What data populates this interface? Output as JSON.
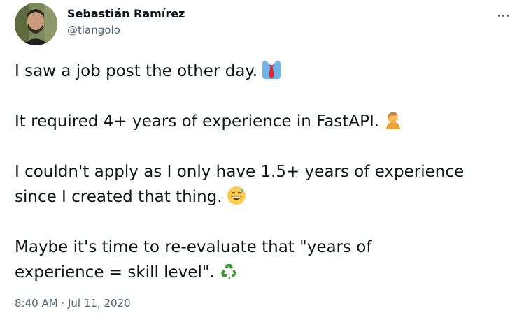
{
  "author": {
    "name": "Sebastián Ramírez",
    "handle": "@tiangolo",
    "avatar": "profile-photo"
  },
  "menu": {
    "icon": "more-horizontal-icon"
  },
  "tweet": {
    "paragraphs": [
      {
        "lines": [
          "I saw a job post the other day."
        ],
        "emoji": "necktie-emoji"
      },
      {
        "lines": [
          "It required 4+ years of experience in FastAPI."
        ],
        "emoji": "facepalm-emoji"
      },
      {
        "lines": [
          "I couldn't apply as I only have 1.5+ years of experience",
          "since I created that thing."
        ],
        "emoji": "grinning-sweat-emoji"
      },
      {
        "lines": [
          "Maybe it's time to re-evaluate that \"years of",
          "experience = skill level\"."
        ],
        "emoji": "recycle-emoji"
      }
    ]
  },
  "timestamp": "8:40 AM · Jul 11, 2020",
  "colors": {
    "text_primary": "#0f1419",
    "text_secondary": "#536471",
    "background": "#ffffff"
  }
}
